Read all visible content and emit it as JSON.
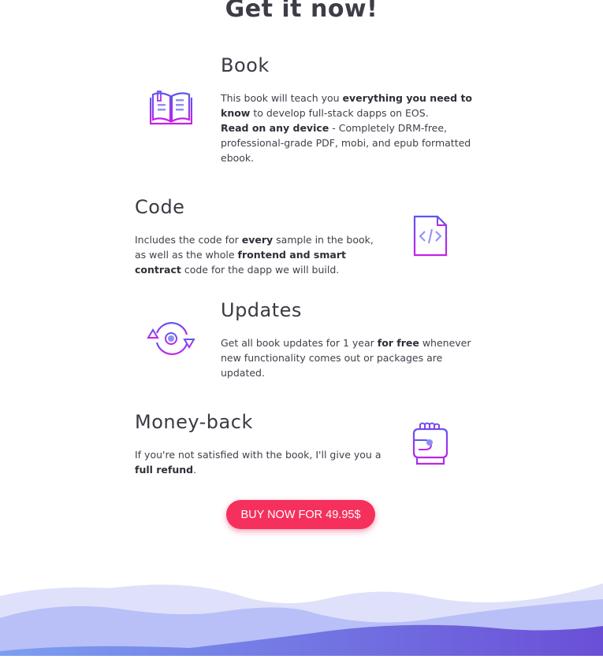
{
  "heading": "Get it now!",
  "features": [
    {
      "title": "Book",
      "icon": "book-icon",
      "segments": [
        {
          "text": "This book will teach you ",
          "bold": false
        },
        {
          "text": "everything you need to know",
          "bold": true
        },
        {
          "text": " to develop full-stack dapps on EOS.",
          "bold": false
        },
        {
          "text": "Read on any device",
          "bold": true
        },
        {
          "text": " - Completely DRM-free, professional-grade PDF, mobi, and epub formatted ebook.",
          "bold": false
        }
      ]
    },
    {
      "title": "Code",
      "icon": "code-file-icon",
      "segments": [
        {
          "text": "Includes the code for ",
          "bold": false
        },
        {
          "text": "every",
          "bold": true
        },
        {
          "text": " sample in the book, as well as the whole ",
          "bold": false
        },
        {
          "text": "frontend and smart contract",
          "bold": true
        },
        {
          "text": " code for the dapp we will build.",
          "bold": false
        }
      ]
    },
    {
      "title": "Updates",
      "icon": "refresh-cycle-icon",
      "segments": [
        {
          "text": "Get all book updates for 1 year ",
          "bold": false
        },
        {
          "text": "for free",
          "bold": true
        },
        {
          "text": " whenever new functionality comes out or packages are updated.",
          "bold": false
        }
      ]
    },
    {
      "title": "Money-back",
      "icon": "money-back-hand-icon",
      "segments": [
        {
          "text": "If you're not satisfied with the book, I'll give you a ",
          "bold": false
        },
        {
          "text": "full refund",
          "bold": true
        },
        {
          "text": ".",
          "bold": false
        }
      ]
    }
  ],
  "buy_button": {
    "label": "BUY NOW FOR 49.95$"
  },
  "colors": {
    "accent": "#f5305d",
    "icon_gradient_start": "#c322e8",
    "icon_gradient_end": "#5c57f2",
    "wave_light": "#dfe1fb",
    "wave_mid": "#b4bcf7",
    "wave_dark": "#6a64dc"
  }
}
